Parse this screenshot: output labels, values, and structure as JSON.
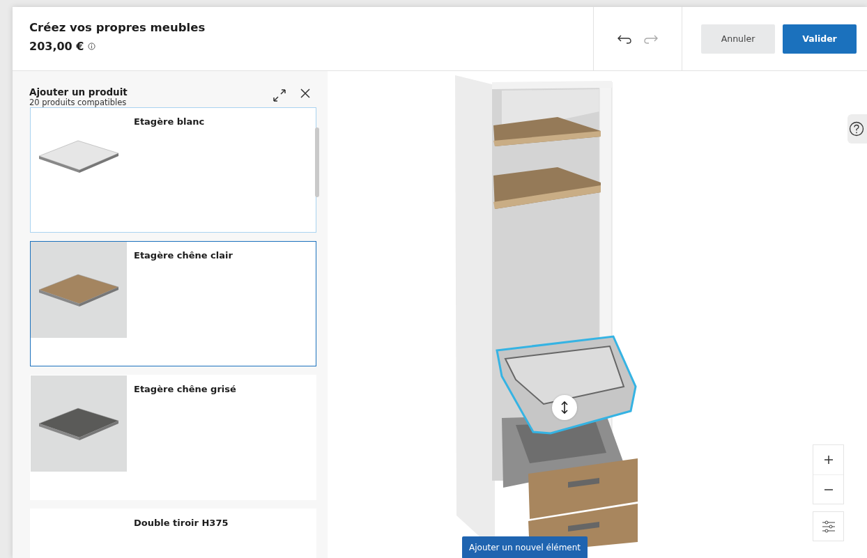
{
  "header": {
    "title": "Créez vos propres meubles",
    "price": "203,00 €",
    "history": [
      {
        "kind": "undo",
        "disabled": false
      },
      {
        "kind": "redo",
        "disabled": true
      }
    ],
    "buttons": [
      {
        "label": "Annuler",
        "kind": "secondary"
      },
      {
        "label": "Valider",
        "kind": "primary"
      }
    ]
  },
  "sidebar": {
    "title": "Ajouter un produit",
    "subtitle": "20 produits compatibles",
    "products": [
      {
        "name": "Etagère blanc",
        "color": "#e6e6e6",
        "selected": false,
        "hovered": true
      },
      {
        "name": "Etagère chêne clair",
        "color": "#a48560",
        "selected": true,
        "hovered": false
      },
      {
        "name": "Etagère chêne grisé",
        "color": "#5a5a58",
        "selected": false,
        "hovered": false
      },
      {
        "name": "Double tiroir H375",
        "selected": false,
        "hovered": false
      }
    ]
  },
  "canvas": {
    "add_button": "Ajouter un nouvel élément"
  }
}
